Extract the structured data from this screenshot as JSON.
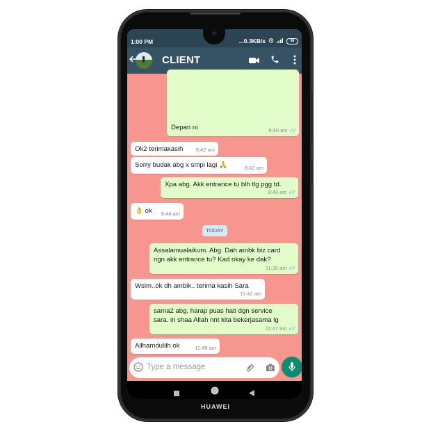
{
  "device": {
    "brand": "HUAWEI"
  },
  "statusbar": {
    "time": "1:00 PM",
    "network_speed": "...0.3KB/s",
    "alarm_icon": "alarm-icon",
    "network_type": "4G",
    "signal_icon": "signal-bars-icon",
    "battery_level": "96"
  },
  "appbar": {
    "back_icon": "arrow-left-icon",
    "contact_name": "CLIENT",
    "video_call_icon": "video-camera-icon",
    "voice_call_icon": "phone-icon",
    "menu_icon": "more-vertical-icon"
  },
  "colors": {
    "chat_background": "#f7968e",
    "header": "#365265",
    "statusbar": "#2d4454",
    "outgoing_bubble": "#e1fcc8",
    "incoming_bubble": "#ffffff",
    "read_tick": "#34b7f1",
    "mic_button": "#0b8c73"
  },
  "messages": [
    {
      "direction": "out",
      "text": "Depan ni",
      "time": "8:40 am",
      "status": "read"
    },
    {
      "direction": "in",
      "text": "Ok2 terimakasih",
      "time": "8:42 am"
    },
    {
      "direction": "in",
      "text": "Sorry budak abg x smpi lagi 🙏",
      "time": "8:42 am"
    },
    {
      "direction": "out",
      "text": "Xpa abg. Akk entrance tu blh tlg pgg td.",
      "time": "8:43 am",
      "status": "read"
    },
    {
      "direction": "in",
      "text": "👌 ok",
      "time": "8:44 am"
    },
    {
      "direction": "out",
      "text": "Assalamualaikum. Abg. Dah ambk biz card ngn akk entrance tu? Kad okay ke dak?",
      "time": "11:36 am",
      "status": "read"
    },
    {
      "direction": "in",
      "text": "Wslm..ok dh ambik.. terima kasih Sara",
      "time": "11:42 am"
    },
    {
      "direction": "out",
      "text": "sama2 abg. harap puas hati dgn service sara. in shaa Allah nnt kita bekerjasama lg",
      "time": "11:47 am",
      "status": "read"
    },
    {
      "direction": "in",
      "text": "Allhamdulilh ok",
      "time": "11:48 am"
    }
  ],
  "day_separator": "TODAY",
  "composer": {
    "placeholder": "Type a message",
    "emoji_icon": "emoji-icon",
    "attach_icon": "paperclip-icon",
    "camera_icon": "camera-icon",
    "mic_icon": "microphone-icon"
  },
  "navbar": {
    "recents_icon": "square-icon",
    "home_icon": "circle-icon",
    "back_icon": "triangle-back-icon"
  },
  "read_tick_glyph": "✓✓"
}
